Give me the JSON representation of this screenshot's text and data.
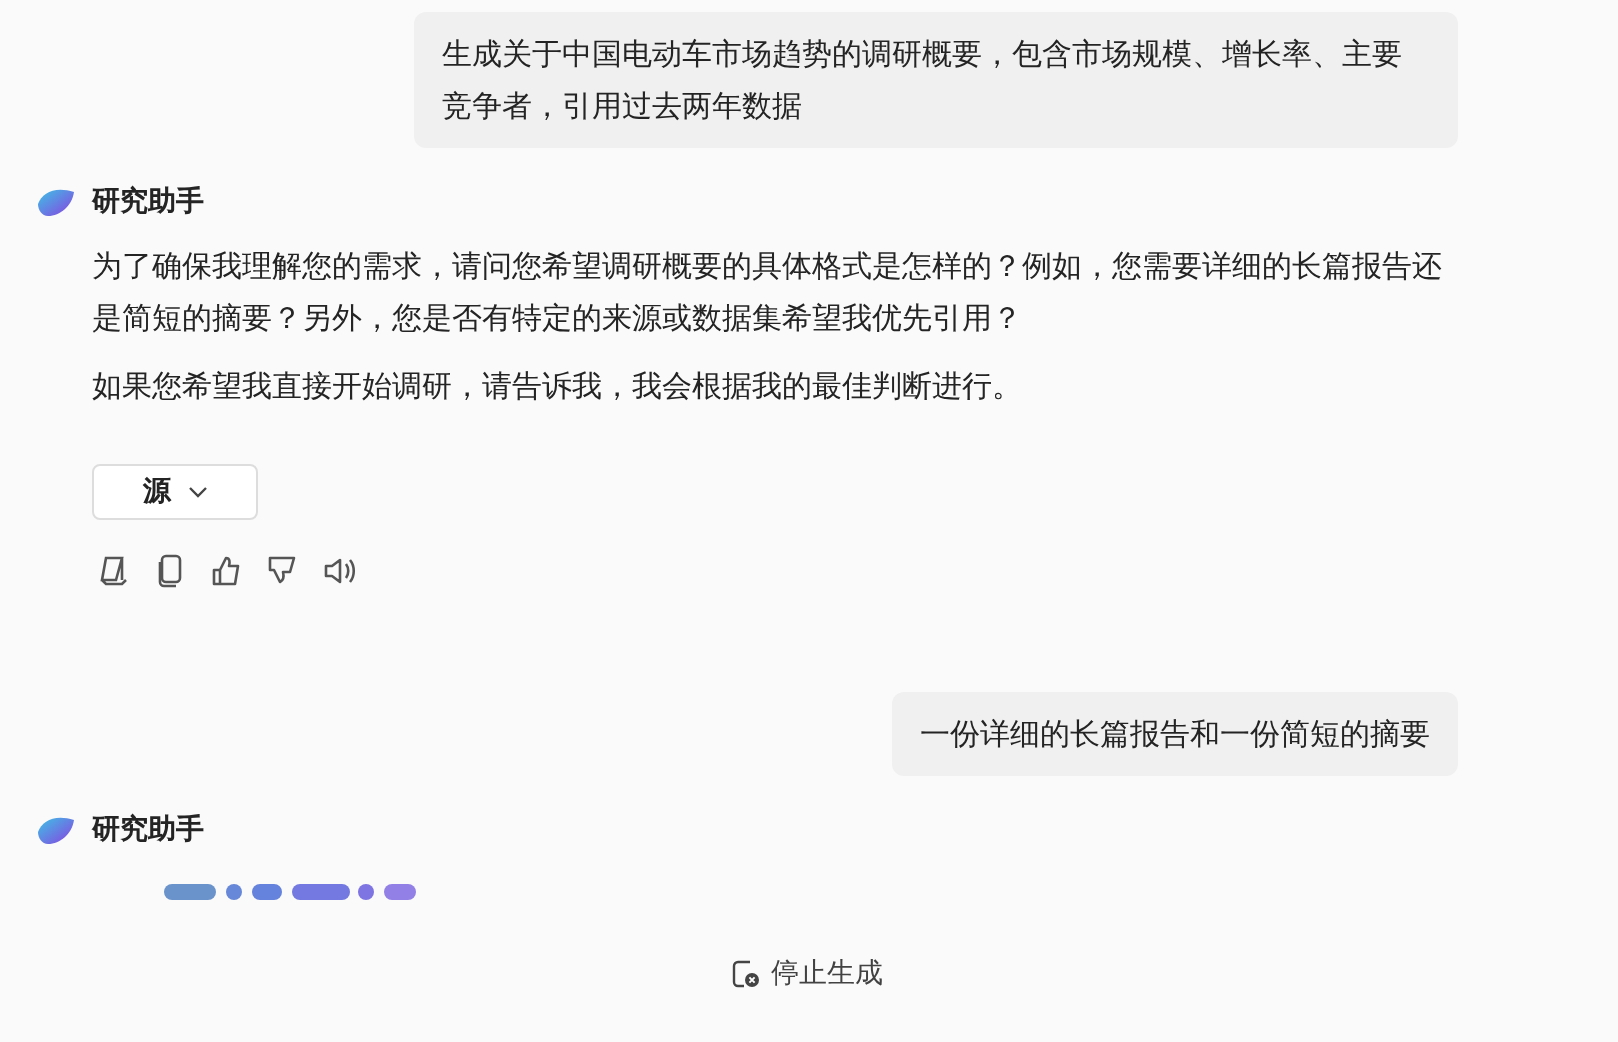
{
  "messages": [
    {
      "kind": "user",
      "text": "生成关于中国电动车市场趋势的调研概要，包含市场规模、增长率、主要竞争者，引用过去两年数据"
    },
    {
      "kind": "assistant",
      "name": "研究助手",
      "paragraphs": [
        "为了确保我理解您的需求，请问您希望调研概要的具体格式是怎样的？例如，您需要详细的长篇报告还是简短的摘要？另外，您是否有特定的来源或数据集希望我优先引用？",
        "如果您希望我直接开始调研，请告诉我，我会根据我的最佳判断进行。"
      ],
      "sources_button": "源"
    },
    {
      "kind": "user",
      "text": "一份详细的长篇报告和一份简短的摘要"
    },
    {
      "kind": "assistant",
      "name": "研究助手",
      "loading": true
    }
  ],
  "stop_button": "停止生成"
}
